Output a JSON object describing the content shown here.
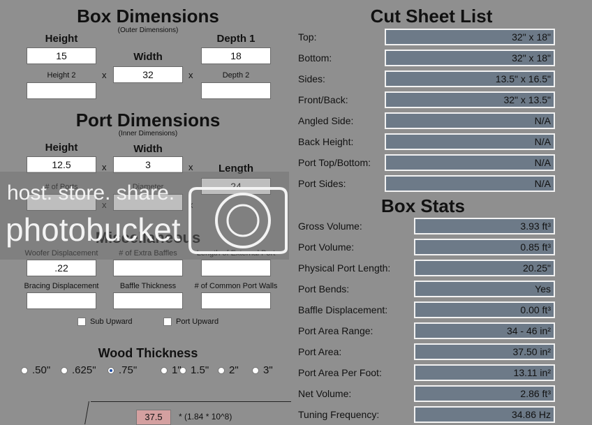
{
  "box_dimensions": {
    "title": "Box Dimensions",
    "subtitle": "(Outer Dimensions)",
    "height_label": "Height",
    "height_value": "15",
    "width_label": "Width",
    "width_value": "32",
    "depth1_label": "Depth 1",
    "depth1_value": "18",
    "height2_label": "Height 2",
    "height2_value": "",
    "depth2_label": "Depth 2",
    "depth2_value": "",
    "times": "x"
  },
  "port_dimensions": {
    "title": "Port Dimensions",
    "subtitle": "(Inner Dimensions)",
    "height_label": "Height",
    "height_value": "12.5",
    "width_label": "Width",
    "width_value": "3",
    "length_label": "Length",
    "length_value": "24",
    "num_ports_label": "# of Ports",
    "diameter_label": "Diameter",
    "times": "x"
  },
  "misc": {
    "title": "Miscellaneous",
    "woofer_disp_label": "Woofer Displacement",
    "woofer_disp_value": ".22",
    "extra_baffles_label": "# of Extra Baffles",
    "extra_baffles_value": "",
    "ext_port_label": "Length of External Port",
    "ext_port_value": "",
    "bracing_label": "Bracing Displacement",
    "bracing_value": "",
    "baffle_thick_label": "Baffle Thickness",
    "baffle_thick_value": "",
    "common_walls_label": "# of Common Port Walls",
    "common_walls_value": "",
    "sub_upward": "Sub Upward",
    "port_upward": "Port Upward"
  },
  "wood_thickness": {
    "title": "Wood Thickness",
    "options": [
      ".50\"",
      ".625\"",
      ".75\"",
      "1\"",
      "1.5\"",
      "2\"",
      "3\""
    ],
    "selected_index": 2
  },
  "bottom_calc": {
    "value": "37.5",
    "formula": "* (1.84 * 10^8)"
  },
  "watermark": {
    "line1": "host. store. share.",
    "line2": "photobucket"
  },
  "cut_sheet": {
    "title": "Cut Sheet List",
    "rows": [
      {
        "label": "Top:",
        "value": "32\" x 18\""
      },
      {
        "label": "Bottom:",
        "value": "32\" x 18\""
      },
      {
        "label": "Sides:",
        "value": "13.5\" x 16.5\""
      },
      {
        "label": "Front/Back:",
        "value": "32\" x 13.5\""
      },
      {
        "label": "Angled Side:",
        "value": "N/A"
      },
      {
        "label": "Back Height:",
        "value": "N/A"
      },
      {
        "label": "Port Top/Bottom:",
        "value": "N/A"
      },
      {
        "label": "Port Sides:",
        "value": "N/A"
      }
    ]
  },
  "box_stats": {
    "title": "Box Stats",
    "rows": [
      {
        "label": "Gross Volume:",
        "value": "3.93 ft³"
      },
      {
        "label": "Port Volume:",
        "value": "0.85 ft³"
      },
      {
        "label": "Physical Port Length:",
        "value": "20.25\""
      },
      {
        "label": "Port Bends:",
        "value": "Yes"
      },
      {
        "label": "Baffle Displacement:",
        "value": "0.00 ft³"
      },
      {
        "label": "Port Area Range:",
        "value": "34 - 46 in²"
      },
      {
        "label": "Port Area:",
        "value": "37.50 in²"
      },
      {
        "label": "Port Area Per Foot:",
        "value": "13.11 in²"
      },
      {
        "label": "Net Volume:",
        "value": "2.86 ft³"
      },
      {
        "label": "Tuning Frequency:",
        "value": "34.86 Hz"
      }
    ]
  }
}
